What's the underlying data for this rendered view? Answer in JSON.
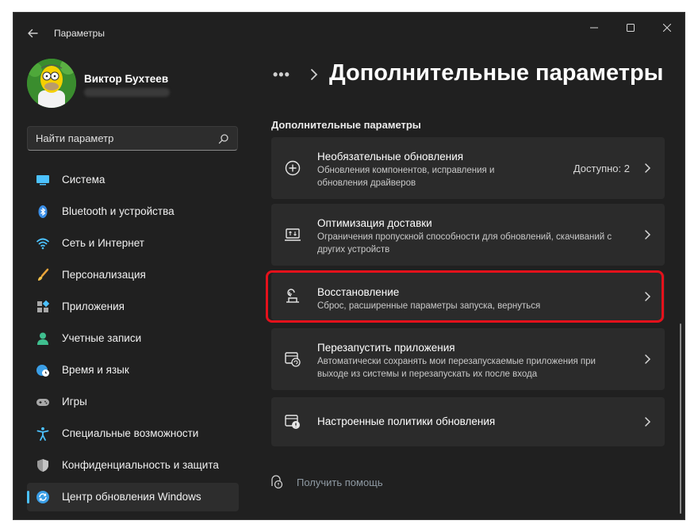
{
  "window": {
    "title": "Параметры"
  },
  "user": {
    "name": "Виктор Бухтеев"
  },
  "search": {
    "placeholder": "Найти параметр"
  },
  "nav": {
    "items": [
      {
        "label": "Система",
        "icon": "display-icon"
      },
      {
        "label": "Bluetooth и устройства",
        "icon": "bluetooth-icon"
      },
      {
        "label": "Сеть и Интернет",
        "icon": "wifi-icon"
      },
      {
        "label": "Персонализация",
        "icon": "brush-icon"
      },
      {
        "label": "Приложения",
        "icon": "apps-icon"
      },
      {
        "label": "Учетные записи",
        "icon": "person-icon"
      },
      {
        "label": "Время и язык",
        "icon": "globe-clock-icon"
      },
      {
        "label": "Игры",
        "icon": "gamepad-icon"
      },
      {
        "label": "Специальные возможности",
        "icon": "accessibility-icon"
      },
      {
        "label": "Конфиденциальность и защита",
        "icon": "shield-icon"
      },
      {
        "label": "Центр обновления Windows",
        "icon": "update-icon",
        "active": true
      }
    ]
  },
  "header": {
    "more": "•••",
    "title": "Дополнительные параметры"
  },
  "section": {
    "title": "Дополнительные параметры"
  },
  "cards": [
    {
      "title": "Необязательные обновления",
      "desc": "Обновления компонентов, исправления и обновления драйверов",
      "value": "Доступно: 2",
      "icon": "plus-circle-icon"
    },
    {
      "title": "Оптимизация доставки",
      "desc": "Ограничения пропускной способности для обновлений, скачиваний с других устройств",
      "icon": "delivery-optimization-icon"
    },
    {
      "title": "Восстановление",
      "desc": "Сброс, расширенные параметры запуска, вернуться",
      "icon": "recovery-icon"
    },
    {
      "title": "Перезапустить приложения",
      "desc": "Автоматически сохранять мои перезапускаемые приложения при выходе из системы и перезапускать их после входа",
      "icon": "restart-apps-icon"
    },
    {
      "title": "Настроенные политики обновления",
      "icon": "update-policy-icon"
    }
  ],
  "help": {
    "label": "Получить помощь",
    "icon": "help-icon"
  },
  "colors": {
    "accent": "#4cc2ff",
    "highlight": "#e4111b",
    "background": "#202020",
    "card": "#2b2b2b"
  }
}
